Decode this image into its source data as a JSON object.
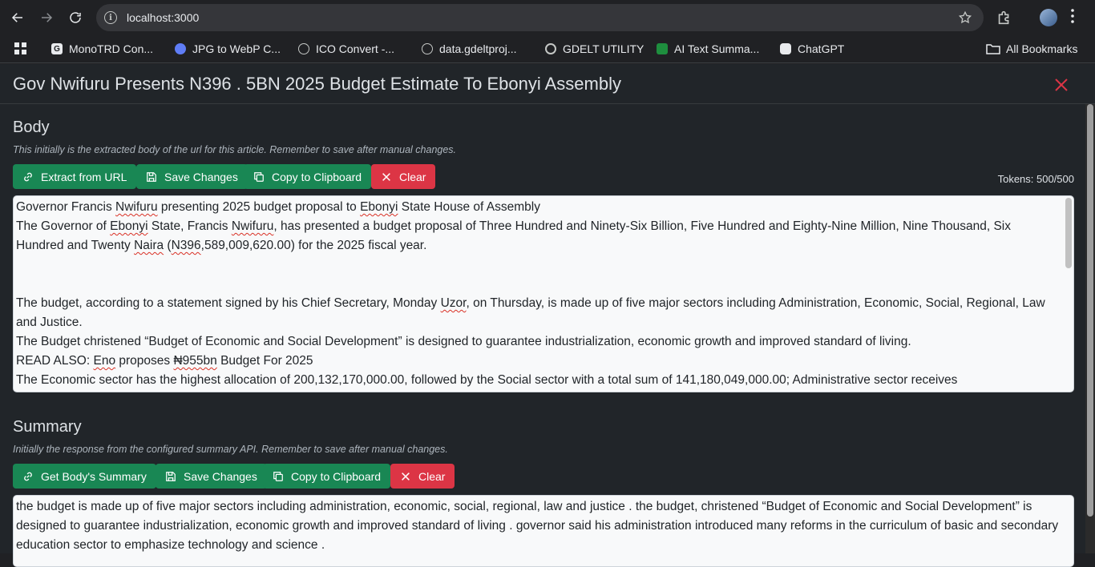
{
  "browser": {
    "url": "localhost:3000",
    "bookmarks": [
      "MonoTRD Con...",
      "JPG to WebP C...",
      "ICO Convert -...",
      "data.gdeltproj...",
      "GDELT UTILITY",
      "AI Text Summa...",
      "ChatGPT"
    ],
    "all_bookmarks": "All Bookmarks"
  },
  "page": {
    "title": "Gov Nwifuru Presents N396 . 5BN 2025 Budget Estimate To Ebonyi Assembly"
  },
  "body_section": {
    "title": "Body",
    "hint": "This initially is the extracted body of the url for this article. Remember to save after manual changes.",
    "buttons": {
      "extract": "Extract from URL",
      "save": "Save Changes",
      "copy": "Copy to Clipboard",
      "clear": "Clear"
    },
    "tokens": "Tokens: 500/500",
    "paragraphs": [
      "Governor Francis Nwifuru presenting 2025 budget proposal to Ebonyi State House of Assembly",
      "The Governor of Ebonyi State, Francis Nwifuru, has presented a budget proposal of Three Hundred and Ninety-Six Billion, Five Hundred and Eighty-Nine Million, Nine Thousand, Six Hundred and Twenty Naira (N396,589,009,620.00) for the 2025 fiscal year.",
      "",
      "The budget, according to a statement signed by his Chief Secretary, Monday Uzor, on Thursday, is made up of five major sectors including Administration, Economic, Social, Regional, Law and Justice.",
      "The Budget christened “Budget of Economic and Social Development” is designed to guarantee industrialization, economic growth and improved standard of living.",
      "READ ALSO: Eno proposes ₦955bn Budget For 2025",
      "The Economic sector has the highest allocation of 200,132,170,000.00, followed by the Social sector with a total sum of 141,180,049,000.00; Administrative sector receives"
    ]
  },
  "summary_section": {
    "title": "Summary",
    "hint": "Initially the response from the configured summary API. Remember to save after manual changes.",
    "buttons": {
      "summary": "Get Body's Summary",
      "save": "Save Changes",
      "copy": "Copy to Clipboard",
      "clear": "Clear"
    },
    "text": "the budget is made up of five major sectors including administration, economic, social, regional, law and justice . the budget, christened “Budget of Economic and Social Development” is designed to guarantee industrialization, economic growth and improved standard of living . governor said his administration introduced many reforms in the curriculum of basic and secondary education sector to emphasize technology and science ."
  }
}
